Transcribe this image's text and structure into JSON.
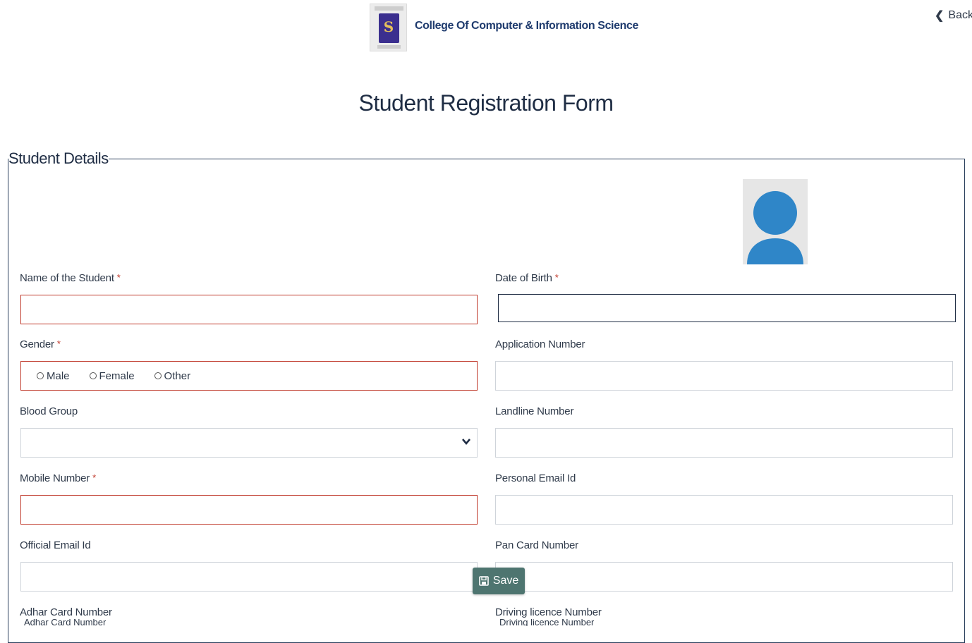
{
  "header": {
    "college_name": "College Of Computer & Information Science",
    "back_label": "Back",
    "logo_icon": "university-crest-icon"
  },
  "page": {
    "title": "Student Registration Form"
  },
  "section": {
    "legend": "Student Details"
  },
  "fields": {
    "student_name": {
      "label": "Name of the Student",
      "required": "*",
      "value": ""
    },
    "dob": {
      "label": "Date of Birth",
      "required": "*",
      "value": ""
    },
    "gender": {
      "label": "Gender",
      "required": "*",
      "options": [
        "Male",
        "Female",
        "Other"
      ]
    },
    "application_number": {
      "label": "Application Number",
      "value": ""
    },
    "blood_group": {
      "label": "Blood Group",
      "value": ""
    },
    "landline": {
      "label": "Landline Number",
      "value": ""
    },
    "mobile": {
      "label": "Mobile Number",
      "required": "*",
      "value": ""
    },
    "personal_email": {
      "label": "Personal Email Id",
      "value": ""
    },
    "official_email": {
      "label": "Official Email Id",
      "value": ""
    },
    "pan": {
      "label": "Pan Card Number",
      "value": ""
    },
    "adhar": {
      "label": "Adhar Card Number",
      "placeholder": "Adhar Card Number"
    },
    "driving_licence": {
      "label": "Driving licence Number",
      "placeholder": "Driving licence Number"
    }
  },
  "actions": {
    "save_label": "Save"
  },
  "colors": {
    "required": "#c0392b",
    "save_button": "#4e7570",
    "avatar": "#2f86c8"
  }
}
